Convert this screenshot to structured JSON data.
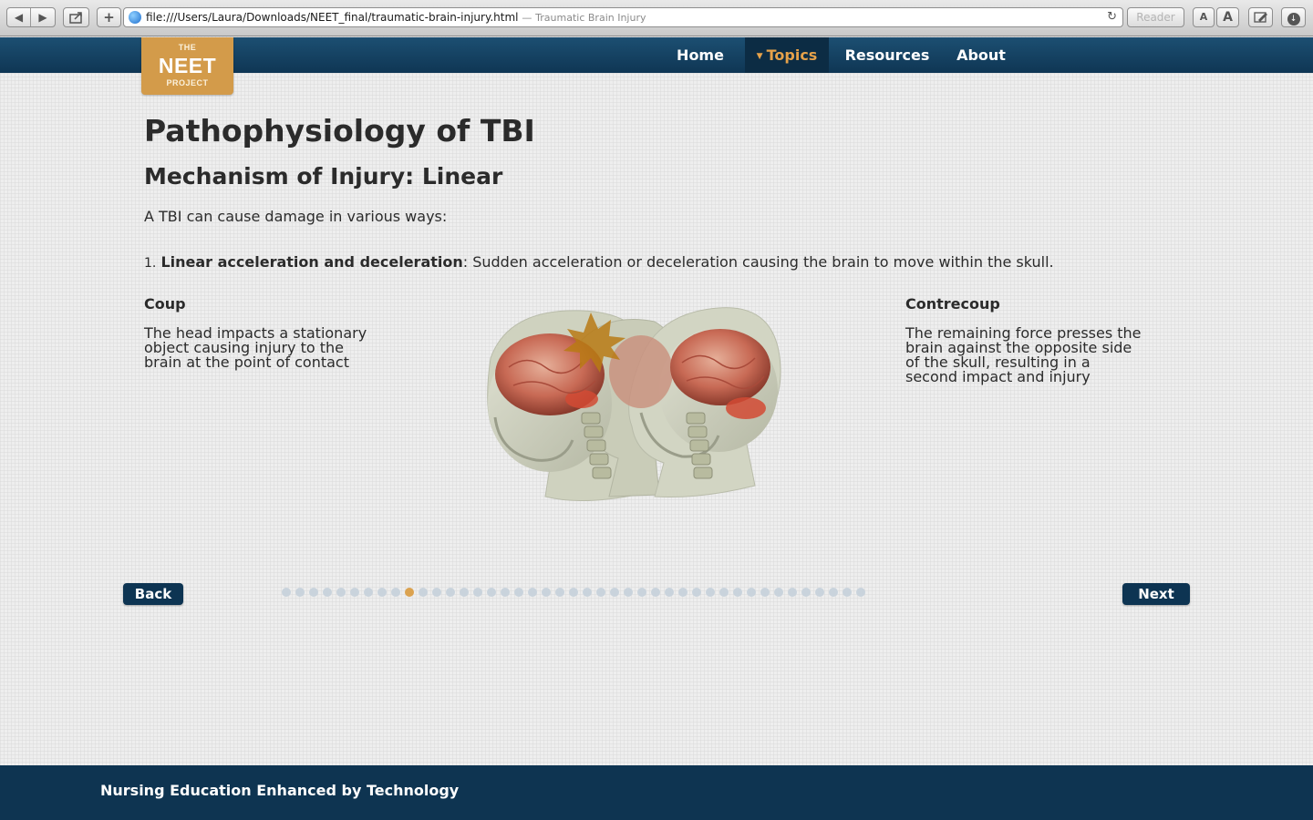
{
  "browser": {
    "url": "file:///Users/Laura/Downloads/NEET_final/traumatic-brain-injury.html",
    "separator": "—",
    "page_title": "Traumatic Brain Injury",
    "reader_label": "Reader",
    "font_small_label": "A",
    "font_large_label": "A",
    "back_icon": "◀",
    "forward_icon": "▶",
    "add_icon": "+",
    "reload_icon": "↻"
  },
  "logo": {
    "the": "THE",
    "neet": "NEET",
    "project": "PROJECT"
  },
  "nav": {
    "home": "Home",
    "topics": "Topics",
    "resources": "Resources",
    "about": "About",
    "active": "Topics"
  },
  "content": {
    "title": "Pathophysiology of TBI",
    "subtitle": "Mechanism of Injury: Linear",
    "intro": "A TBI can cause damage in various ways:",
    "point_number": "1.",
    "point_term": "Linear acceleration and deceleration",
    "point_desc": ": Sudden acceleration or deceleration causing the brain to move within the skull.",
    "coup": {
      "title": "Coup",
      "body": "The head impacts a stationary object causing injury to the brain at the point of contact"
    },
    "contrecoup": {
      "title": "Contrecoup",
      "body": "The remaining force presses the brain against the opposite side of the skull, resulting in a second impact and injury"
    }
  },
  "pager": {
    "back_label": "Back",
    "next_label": "Next",
    "total_pages": 43,
    "current_page": 10
  },
  "footer": {
    "text": "Nursing Education Enhanced by Technology"
  },
  "colors": {
    "header": "#0f3654",
    "accent": "#d39b4a",
    "footer": "#0e3451",
    "dot_inactive": "#c9d3dc",
    "dot_active": "#dba24f"
  }
}
